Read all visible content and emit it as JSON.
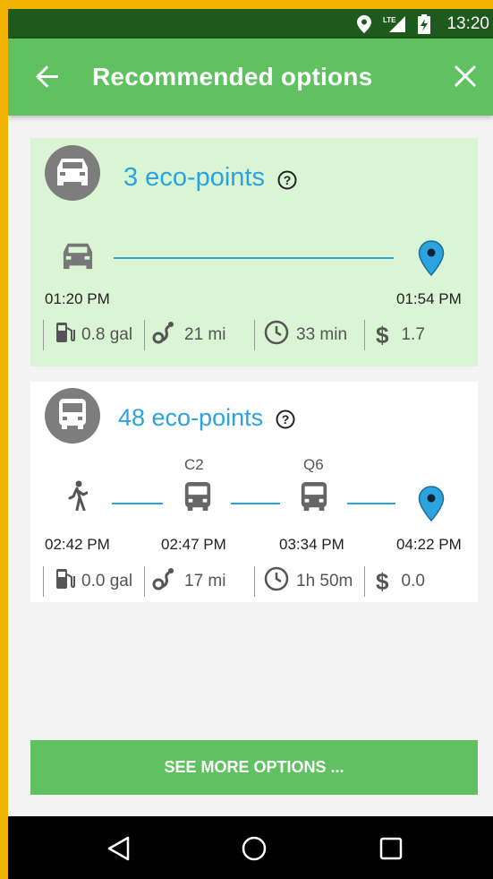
{
  "status_bar": {
    "network": "LTE",
    "time": "13:20"
  },
  "app_bar": {
    "title": "Recommended options"
  },
  "options": [
    {
      "mode": "car",
      "eco_points": "3 eco-points",
      "times": [
        "01:20 PM",
        "01:54 PM"
      ],
      "stats": {
        "fuel": "0.8 gal",
        "distance": "21 mi",
        "duration": "33 min",
        "cost": "1.7"
      }
    },
    {
      "mode": "bus",
      "eco_points": "48 eco-points",
      "routes": [
        "C2",
        "Q6"
      ],
      "times": [
        "02:42 PM",
        "02:47 PM",
        "03:34 PM",
        "04:22 PM"
      ],
      "stats": {
        "fuel": "0.0 gal",
        "distance": "17 mi",
        "duration": "1h 50m",
        "cost": "0.0"
      }
    }
  ],
  "see_more_label": "SEE MORE OPTIONS ...",
  "colors": {
    "primary": "#5fc160",
    "status_bar": "#1e5a1c",
    "accent": "#2aa3de",
    "selected_card": "#d9f5d4"
  }
}
